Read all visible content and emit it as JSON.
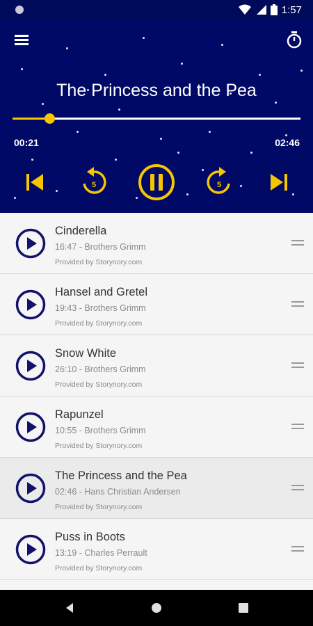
{
  "status": {
    "time": "1:57"
  },
  "player": {
    "title": "The Princess and the Pea",
    "elapsed": "00:21",
    "duration": "02:46",
    "progress": 0.127,
    "skip_seconds": "5"
  },
  "playlist": [
    {
      "title": "Cinderella",
      "meta": "16:47 - Brothers Grimm",
      "provider": "Provided by Storynory.com"
    },
    {
      "title": "Hansel and Gretel",
      "meta": "19:43 - Brothers Grimm",
      "provider": "Provided by Storynory.com"
    },
    {
      "title": "Snow White",
      "meta": "26:10 - Brothers Grimm",
      "provider": "Provided by Storynory.com"
    },
    {
      "title": "Rapunzel",
      "meta": "10:55 - Brothers Grimm",
      "provider": "Provided by Storynory.com"
    },
    {
      "title": "The Princess and the Pea",
      "meta": "02:46 - Hans Christian Andersen",
      "provider": "Provided by Storynory.com",
      "active": true
    },
    {
      "title": "Puss in Boots",
      "meta": "13:19 - Charles Perrault",
      "provider": "Provided by Storynory.com"
    }
  ],
  "colors": {
    "header_bg": "#000a66",
    "accent": "#f6c600",
    "icon_navy": "#12126b",
    "list_bg": "#f5f5f5"
  },
  "icons": {
    "status": [
      "notification-dot-icon",
      "wifi-icon",
      "signal-icon",
      "battery-icon"
    ],
    "header": [
      "menu-icon",
      "timer-icon"
    ],
    "controls": [
      "skip-previous-icon",
      "rewind-5-icon",
      "pause-icon",
      "forward-5-icon",
      "skip-next-icon"
    ],
    "row": [
      "play-circle-icon",
      "drag-handle-icon"
    ],
    "nav": [
      "back-icon",
      "home-icon",
      "recents-icon"
    ]
  }
}
